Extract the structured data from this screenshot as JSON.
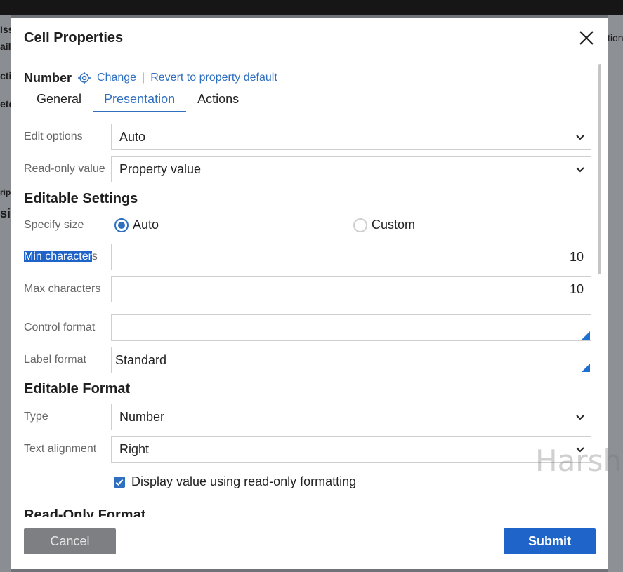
{
  "background": {
    "left_fragments": [
      "Iss",
      "ail",
      "cti",
      "ete",
      "rip",
      "sic"
    ],
    "right_fragments": [
      "tion"
    ]
  },
  "dialog": {
    "title": "Cell Properties",
    "property_name": "Number",
    "change_link": "Change",
    "separator": "|",
    "revert_link": "Revert to property default",
    "tabs": [
      {
        "label": "General",
        "active": false
      },
      {
        "label": "Presentation",
        "active": true
      },
      {
        "label": "Actions",
        "active": false
      }
    ],
    "edit_options": {
      "label": "Edit options",
      "value": "Auto"
    },
    "readonly_value": {
      "label": "Read-only value",
      "value": "Property value"
    },
    "editable_settings": {
      "heading": "Editable Settings",
      "specify_size": {
        "label": "Specify size",
        "options": [
          "Auto",
          "Custom"
        ],
        "selected": "Auto"
      },
      "min_characters": {
        "label_selected": "Min character",
        "label_rest": "s",
        "value": "10"
      },
      "max_characters": {
        "label": "Max characters",
        "value": "10"
      },
      "control_format": {
        "label": "Control format",
        "value": ""
      },
      "label_format": {
        "label": "Label format",
        "value": "Standard"
      }
    },
    "editable_format": {
      "heading": "Editable Format",
      "type": {
        "label": "Type",
        "value": "Number"
      },
      "text_alignment": {
        "label": "Text alignment",
        "value": "Right"
      },
      "display_readonly_formatting": {
        "label": "Display value using read-only formatting",
        "checked": true
      }
    },
    "readonly_format_heading": "Read-Only Format",
    "buttons": {
      "cancel": "Cancel",
      "submit": "Submit"
    }
  },
  "watermark": "Harsh",
  "colors": {
    "accent": "#2f6fbf",
    "submit": "#1f64c8",
    "cancel": "#7d7f83",
    "selection": "#1e63c8"
  }
}
